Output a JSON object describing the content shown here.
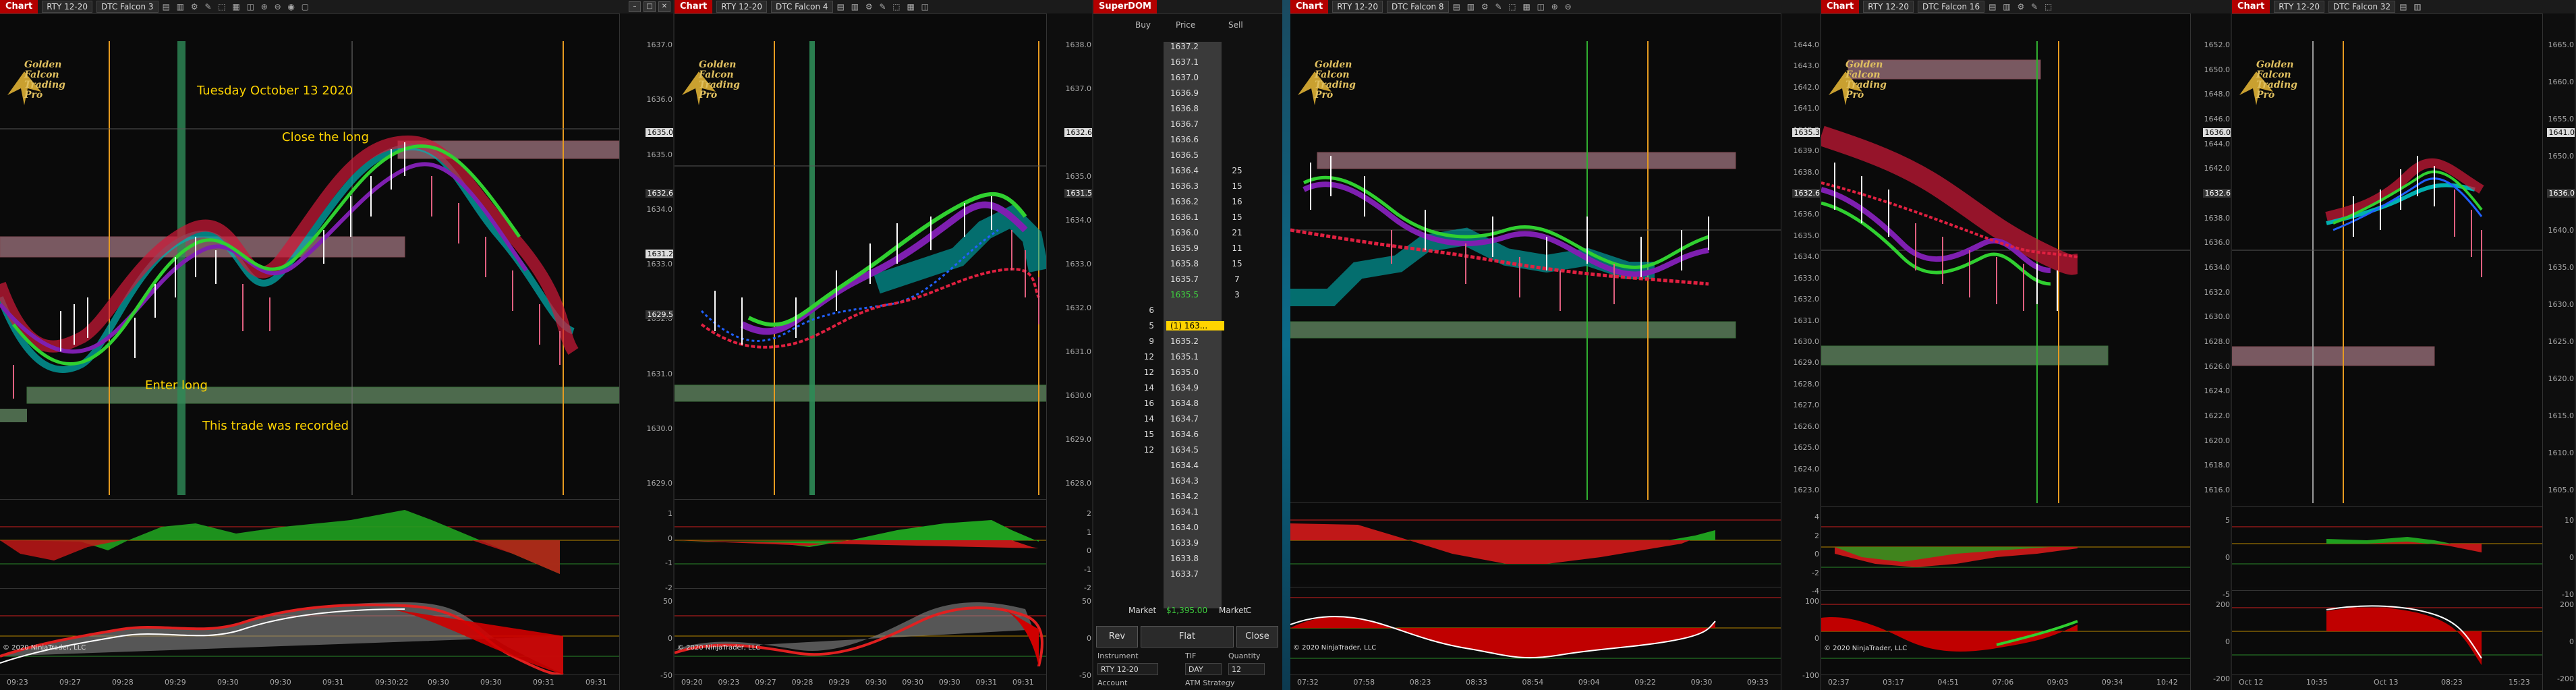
{
  "chart1": {
    "tag": "Chart",
    "instrument": "RTY 12-20",
    "template": "DTC Falcon 3",
    "date_note": "Tuesday October 13 2020",
    "note_close": "Close the long",
    "note_enter": "Enter long",
    "note_recorded": "This trade was recorded",
    "price_ticks": [
      "1637.0",
      "1636.0",
      "1635.0",
      "1634.0",
      "1633.0",
      "1632.0",
      "1631.0",
      "1630.0",
      "1629.0"
    ],
    "price_boxes": [
      "1635.0",
      "1632.6",
      "1631.2",
      "1629.5"
    ],
    "osc1_ticks": [
      "1",
      "0",
      "-1",
      "-2"
    ],
    "osc2_ticks": [
      "50",
      "0",
      "-50"
    ],
    "time_labels": [
      "09:23",
      "09:27",
      "09:28",
      "09:29",
      "09:30",
      "09:30",
      "09:31",
      "09:30:22",
      "09:30",
      "09:30",
      "09:31",
      "09:31"
    ],
    "copyright": "© 2020 NinjaTrader, LLC"
  },
  "chart2": {
    "tag": "Chart",
    "instrument": "RTY 12-20",
    "template": "DTC Falcon 4",
    "price_ticks": [
      "1638.0",
      "1637.0",
      "1636.0",
      "1635.0",
      "1634.0",
      "1633.0",
      "1632.0",
      "1631.0",
      "1630.0",
      "1629.0",
      "1628.0"
    ],
    "price_boxes": [
      "1632.6",
      "1631.5"
    ],
    "osc1_ticks": [
      "2",
      "1",
      "0",
      "-1",
      "-2"
    ],
    "osc2_ticks": [
      "50",
      "0",
      "-50"
    ],
    "time_labels": [
      "09:20",
      "09:23",
      "09:27",
      "09:28",
      "09:29",
      "09:30",
      "09:30",
      "09:30",
      "09:31",
      "09:31"
    ],
    "copyright": "© 2020 NinjaTrader, LLC"
  },
  "superdom": {
    "tag": "SuperDOM",
    "col_buy": "Buy",
    "col_price": "Price",
    "col_sell": "Sell",
    "rows": [
      {
        "buy": "",
        "price": "1637.2",
        "sell": ""
      },
      {
        "buy": "",
        "price": "1637.1",
        "sell": ""
      },
      {
        "buy": "",
        "price": "1637.0",
        "sell": ""
      },
      {
        "buy": "",
        "price": "1636.9",
        "sell": ""
      },
      {
        "buy": "",
        "price": "1636.8",
        "sell": ""
      },
      {
        "buy": "",
        "price": "1636.7",
        "sell": ""
      },
      {
        "buy": "",
        "price": "1636.6",
        "sell": ""
      },
      {
        "buy": "",
        "price": "1636.5",
        "sell": ""
      },
      {
        "buy": "",
        "price": "1636.4",
        "sell": "25"
      },
      {
        "buy": "",
        "price": "1636.3",
        "sell": "15"
      },
      {
        "buy": "",
        "price": "1636.2",
        "sell": "16"
      },
      {
        "buy": "",
        "price": "1636.1",
        "sell": "15"
      },
      {
        "buy": "",
        "price": "1636.0",
        "sell": "21"
      },
      {
        "buy": "",
        "price": "1635.9",
        "sell": "11"
      },
      {
        "buy": "",
        "price": "1635.8",
        "sell": "15"
      },
      {
        "buy": "",
        "price": "1635.7",
        "sell": "7"
      },
      {
        "buy": "",
        "price": "1635.5",
        "sell": "3"
      },
      {
        "buy": "6",
        "price": "",
        "sell": ""
      },
      {
        "buy": "5",
        "price": "(1) 163...",
        "sell": ""
      },
      {
        "buy": "9",
        "price": "1635.2",
        "sell": ""
      },
      {
        "buy": "12",
        "price": "1635.1",
        "sell": ""
      },
      {
        "buy": "12",
        "price": "1635.0",
        "sell": ""
      },
      {
        "buy": "14",
        "price": "1634.9",
        "sell": ""
      },
      {
        "buy": "16",
        "price": "1634.8",
        "sell": ""
      },
      {
        "buy": "14",
        "price": "1634.7",
        "sell": ""
      },
      {
        "buy": "15",
        "price": "1634.6",
        "sell": ""
      },
      {
        "buy": "12",
        "price": "1634.5",
        "sell": ""
      },
      {
        "buy": "",
        "price": "1634.4",
        "sell": ""
      },
      {
        "buy": "",
        "price": "1634.3",
        "sell": ""
      },
      {
        "buy": "",
        "price": "1634.2",
        "sell": ""
      },
      {
        "buy": "",
        "price": "1634.1",
        "sell": ""
      },
      {
        "buy": "",
        "price": "1634.0",
        "sell": ""
      },
      {
        "buy": "",
        "price": "1633.9",
        "sell": ""
      },
      {
        "buy": "",
        "price": "1633.8",
        "sell": ""
      },
      {
        "buy": "",
        "price": "1633.7",
        "sell": ""
      }
    ],
    "market_left": "Market",
    "market_value": "$1,395.00",
    "market_right": "Market",
    "market_c": "C",
    "rev": "Rev",
    "flat": "Flat",
    "close": "Close",
    "instrument_label": "Instrument",
    "tif_label": "TIF",
    "qty_label": "Quantity",
    "instrument": "RTY 12-20",
    "tif": "DAY",
    "qty": "12",
    "account_label": "Account",
    "atm_label": "ATM Strategy"
  },
  "chart3": {
    "tag": "Chart",
    "instrument": "RTY 12-20",
    "template": "DTC Falcon 8",
    "price_ticks": [
      "1644.0",
      "1643.0",
      "1642.0",
      "1641.0",
      "1640.0",
      "1639.0",
      "1638.0",
      "1637.0",
      "1636.0",
      "1635.0",
      "1634.0",
      "1633.0",
      "1632.0",
      "1631.0",
      "1630.0",
      "1629.0",
      "1628.0",
      "1627.0",
      "1626.0",
      "1625.0",
      "1624.0",
      "1623.0"
    ],
    "price_boxes": [
      "1635.3",
      "1632.6"
    ],
    "osc1_ticks": [
      "4",
      "2",
      "0",
      "-2",
      "-4"
    ],
    "osc2_ticks": [
      "100",
      "0",
      "-100"
    ],
    "time_labels": [
      "07:32",
      "07:58",
      "08:23",
      "08:33",
      "08:54",
      "09:04",
      "09:22",
      "09:30",
      "09:33"
    ],
    "copyright": "© 2020 NinjaTrader, LLC"
  },
  "chart4": {
    "tag": "Chart",
    "instrument": "RTY 12-20",
    "template": "DTC Falcon 16",
    "price_ticks": [
      "1652.0",
      "1650.0",
      "1648.0",
      "1646.0",
      "1644.0",
      "1642.0",
      "1640.0",
      "1638.0",
      "1636.0",
      "1634.0",
      "1632.0",
      "1630.0",
      "1628.0",
      "1626.0",
      "1624.0",
      "1622.0",
      "1620.0",
      "1618.0",
      "1616.0"
    ],
    "price_boxes": [
      "1636.0",
      "1632.6"
    ],
    "osc1_ticks": [
      "5",
      "0",
      "-5"
    ],
    "osc2_ticks": [
      "200",
      "0",
      "-200"
    ],
    "time_labels": [
      "02:37",
      "03:17",
      "04:51",
      "07:06",
      "09:03",
      "09:34",
      "10:42"
    ],
    "copyright": "© 2020 NinjaTrader, LLC"
  },
  "chart5": {
    "tag": "Chart",
    "instrument": "RTY 12-20",
    "template": "DTC Falcon 32",
    "price_ticks": [
      "1665.0",
      "1660.0",
      "1655.0",
      "1650.0",
      "1645.0",
      "1640.0",
      "1635.0",
      "1630.0",
      "1625.0",
      "1620.0",
      "1615.0",
      "1610.0",
      "1605.0"
    ],
    "price_boxes": [
      "1641.0",
      "1636.0"
    ],
    "osc1_ticks": [
      "10",
      "0",
      "-10"
    ],
    "osc2_ticks": [
      "200",
      "0",
      "-200"
    ],
    "time_labels": [
      "Oct 12",
      "10:35",
      "Oct 13",
      "08:23",
      "15:23"
    ],
    "copyright": ""
  }
}
